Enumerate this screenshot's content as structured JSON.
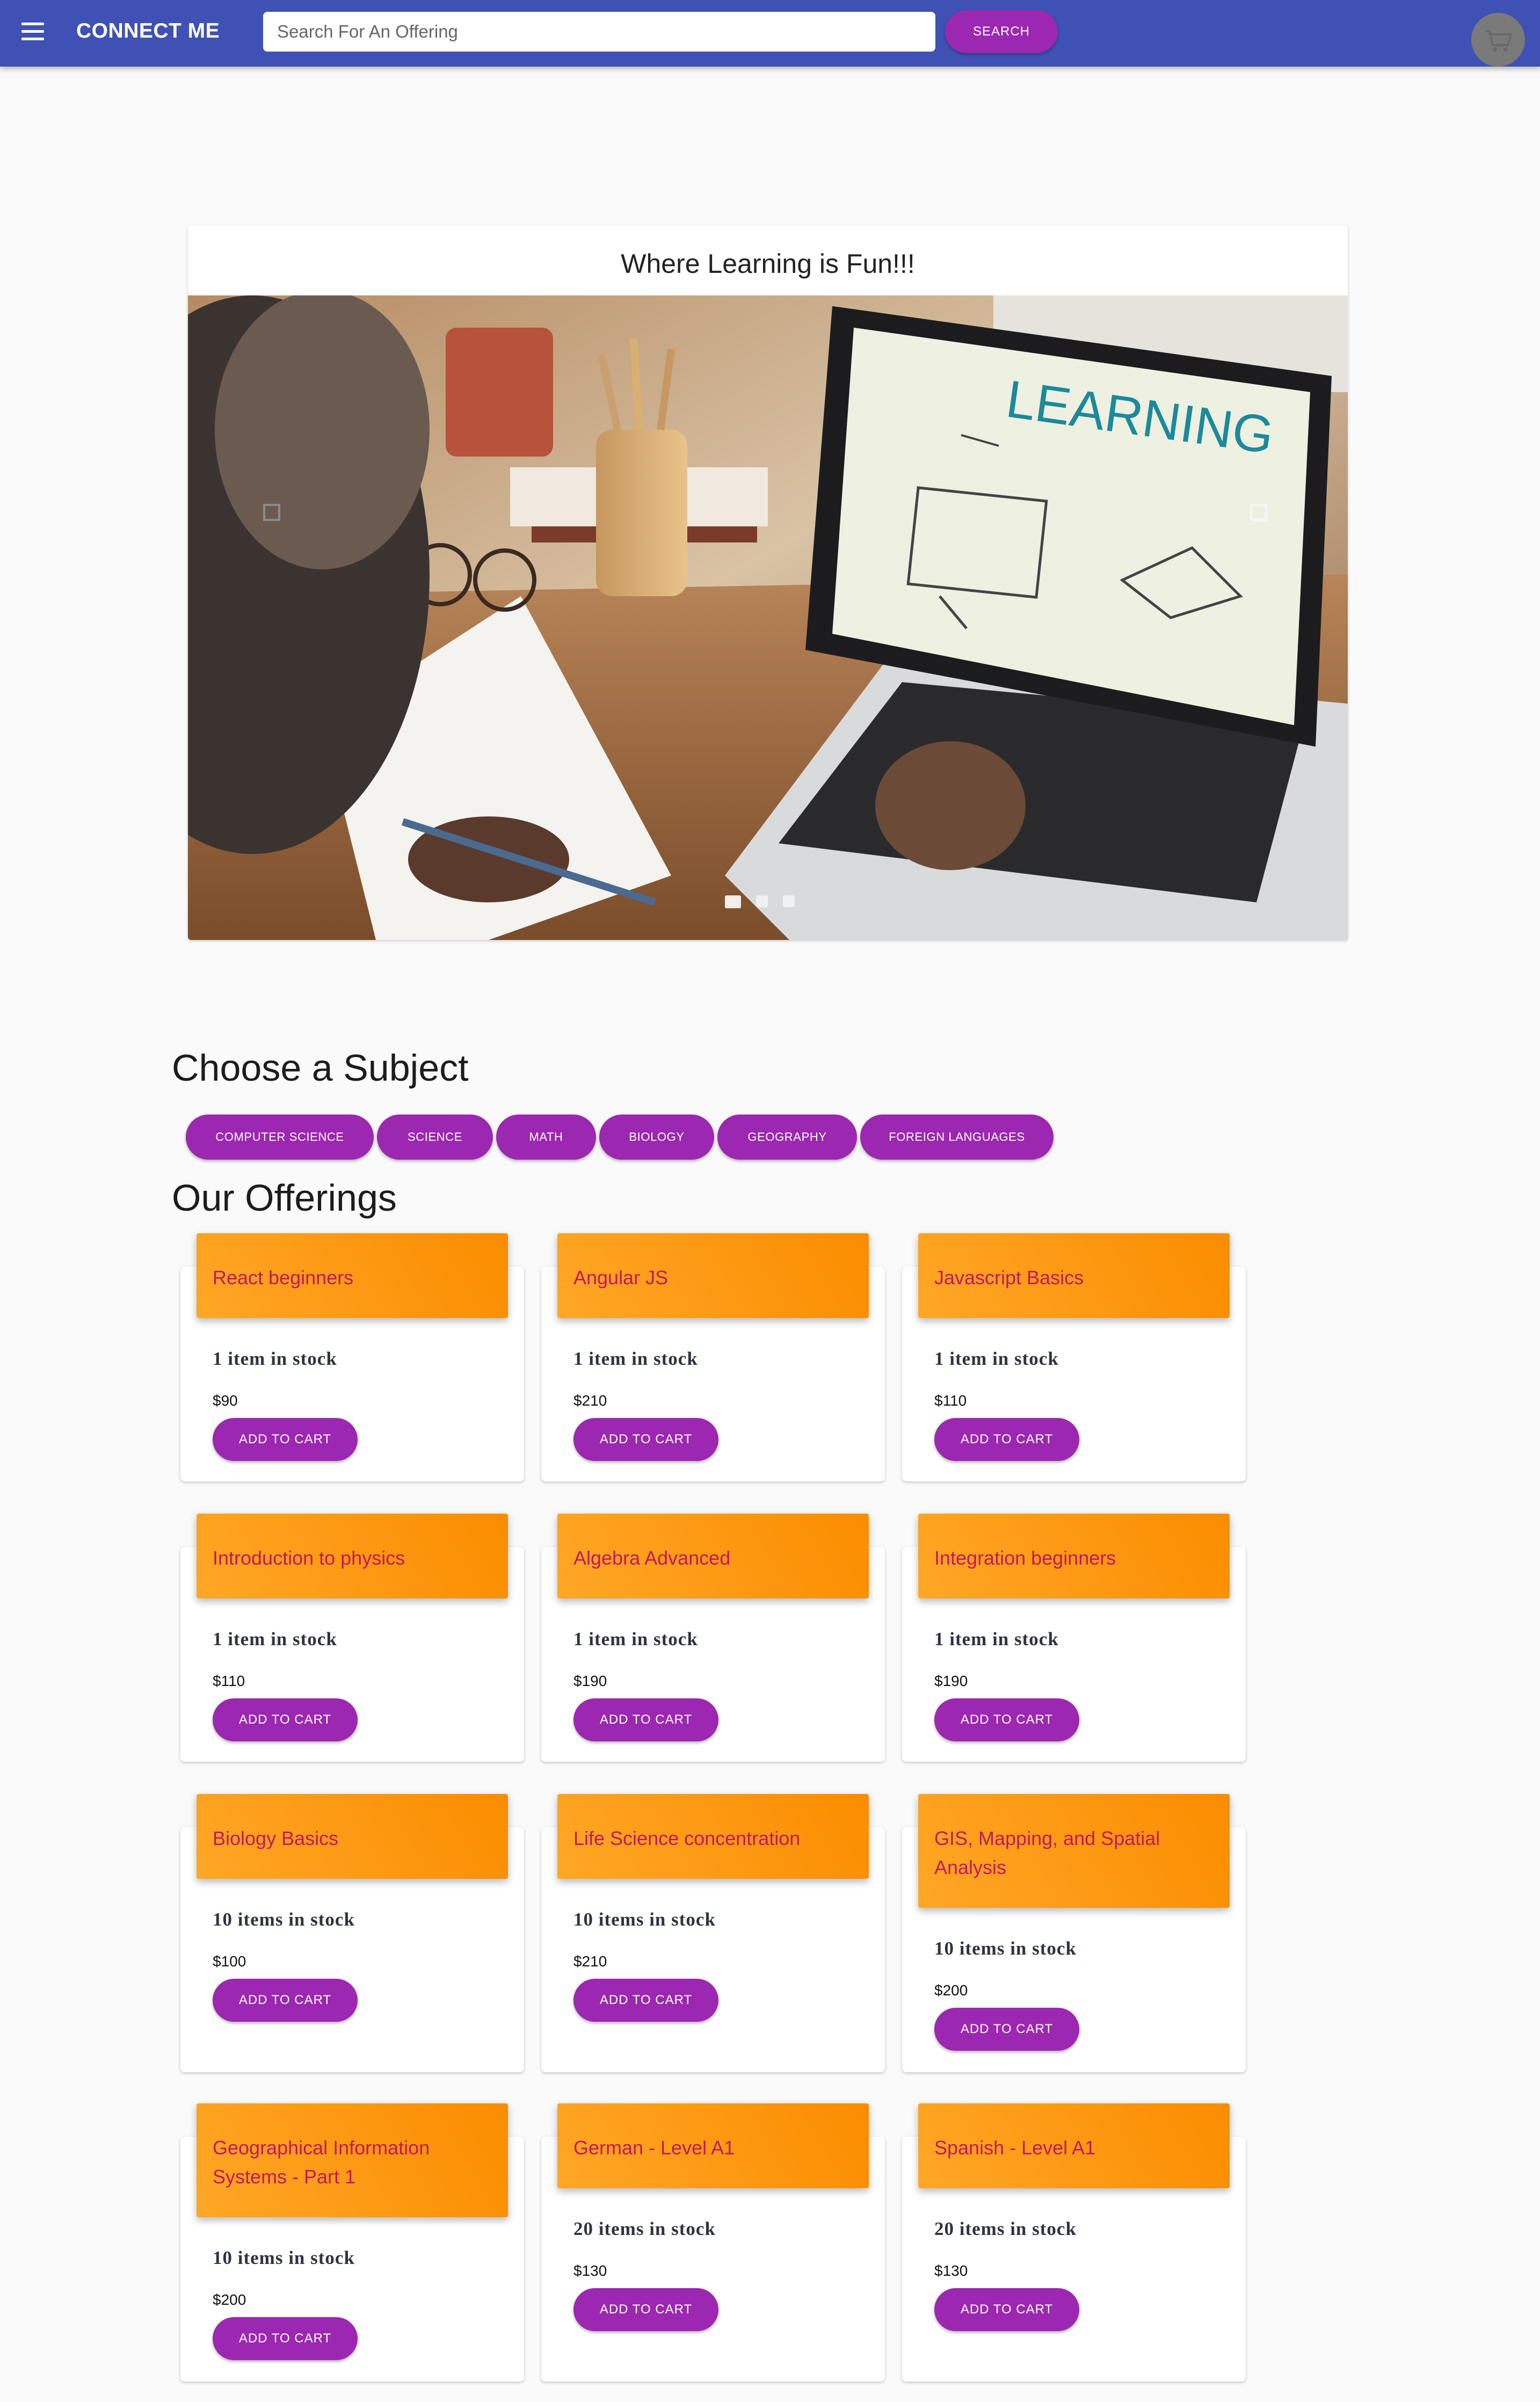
{
  "header": {
    "app_title": "CONNECT ME",
    "search_placeholder": "Search For An Offering",
    "search_button": "SEARCH"
  },
  "hero": {
    "title": "Where Learning is Fun!!!",
    "laptop_screen_text": "LEARNING"
  },
  "subjects": {
    "heading": "Choose a Subject",
    "items": [
      "COMPUTER SCIENCE",
      "SCIENCE",
      "MATH",
      "BIOLOGY",
      "GEOGRAPHY",
      "FOREIGN LANGUAGES"
    ]
  },
  "offerings": {
    "heading": "Our Offerings",
    "cart_label": "ADD TO CART",
    "items": [
      {
        "title": "React beginners",
        "stock": "1 item in stock",
        "price": "$90"
      },
      {
        "title": "Angular JS",
        "stock": "1 item in stock",
        "price": "$210"
      },
      {
        "title": "Javascript Basics",
        "stock": "1 item in stock",
        "price": "$110"
      },
      {
        "title": "Introduction to physics",
        "stock": "1 item in stock",
        "price": "$110"
      },
      {
        "title": "Algebra Advanced",
        "stock": "1 item in stock",
        "price": "$190"
      },
      {
        "title": "Integration beginners",
        "stock": "1 item in stock",
        "price": "$190"
      },
      {
        "title": "Biology Basics",
        "stock": "10 items in stock",
        "price": "$100"
      },
      {
        "title": "Life Science concentration",
        "stock": "10 items in stock",
        "price": "$210"
      },
      {
        "title": "GIS, Mapping, and Spatial Analysis",
        "stock": "10 items in stock",
        "price": "$200"
      },
      {
        "title": "Geographical Information Systems - Part 1",
        "stock": "10 items in stock",
        "price": "$200"
      },
      {
        "title": "German - Level A1",
        "stock": "20 items in stock",
        "price": "$130"
      },
      {
        "title": "Spanish - Level A1",
        "stock": "20 items in stock",
        "price": "$130"
      }
    ]
  },
  "colors": {
    "appbar": "#3f51b5",
    "accent_purple": "#9c27b0",
    "card_header_orange": "#fb8c00",
    "card_title_pink": "#c2185b"
  }
}
